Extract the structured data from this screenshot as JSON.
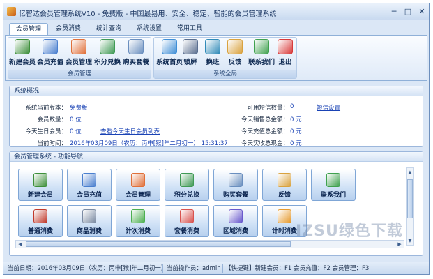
{
  "window": {
    "title": "亿智达会员管理系统V10 - 免费版 - 中国最易用、安全、稳定、智能的会员管理系统",
    "min_glyph": "─",
    "max_glyph": "□",
    "close_glyph": "✕"
  },
  "tabs": [
    {
      "label": "会员管理",
      "active": true
    },
    {
      "label": "会员消费"
    },
    {
      "label": "统计查询"
    },
    {
      "label": "系统设置"
    },
    {
      "label": "常用工具"
    }
  ],
  "ribbon": {
    "groups": [
      {
        "caption": "会员管理",
        "buttons": [
          {
            "label": "新建会员",
            "icon": "add-user-icon",
            "color": "#3d8f3a"
          },
          {
            "label": "会员充值",
            "icon": "pen-icon",
            "color": "#4a7fcf"
          },
          {
            "label": "会员管理",
            "icon": "member-card-icon",
            "color": "#e0703a"
          },
          {
            "label": "积分兑换",
            "icon": "gift-icon",
            "color": "#3f9a55"
          },
          {
            "label": "购买套餐",
            "icon": "basket-icon",
            "color": "#6a8fbf"
          }
        ]
      },
      {
        "caption": "系统全局",
        "buttons": [
          {
            "label": "系统首页",
            "icon": "home-icon",
            "color": "#3f8ed6"
          },
          {
            "label": "锁屏",
            "icon": "lock-icon",
            "color": "#5a6f90"
          },
          {
            "label": "换班",
            "icon": "shift-change-icon",
            "color": "#2f8ab8"
          },
          {
            "label": "反馈",
            "icon": "feedback-icon",
            "color": "#d9a23e"
          },
          {
            "label": "联系我们",
            "icon": "phone-icon",
            "color": "#3fa14e"
          },
          {
            "label": "退出",
            "icon": "power-icon",
            "color": "#d83a3a"
          }
        ]
      }
    ]
  },
  "overview": {
    "header": "系统概况",
    "left": [
      {
        "label": "系统当前版本：",
        "value": "免费版"
      },
      {
        "label": "会员数量：",
        "value": "0 位"
      },
      {
        "label": "今天生日会员：",
        "value": "0 位",
        "link": "查看今天生日会员列表"
      },
      {
        "label": "当前时间：",
        "value": "2016年03月09日（农历：丙申[猴]年二月初一）   15:31:37"
      }
    ],
    "right": [
      {
        "label": "可用短信数量：",
        "value": "0",
        "link": "短信设置"
      },
      {
        "label": "今天销售总金额：",
        "value": "0 元"
      },
      {
        "label": "今天充值总金额：",
        "value": "0 元"
      },
      {
        "label": "今天实收总现金：",
        "value": "0 元"
      }
    ]
  },
  "nav": {
    "header": "会员管理系统 - 功能导航",
    "tiles": [
      {
        "label": "新建会员",
        "icon": "add-user-icon",
        "color": "#3d8f3a"
      },
      {
        "label": "会员充值",
        "icon": "pen-icon",
        "color": "#4a7fcf"
      },
      {
        "label": "会员管理",
        "icon": "member-card-icon",
        "color": "#e0703a"
      },
      {
        "label": "积分兑换",
        "icon": "gift-icon",
        "color": "#3f9a55"
      },
      {
        "label": "购买套餐",
        "icon": "basket-icon",
        "color": "#6a8fbf"
      },
      {
        "label": "反馈",
        "icon": "feedback-icon",
        "color": "#d9a23e"
      },
      {
        "label": "联系我们",
        "icon": "phone-icon",
        "color": "#3fa14e"
      },
      {
        "label": "普通消费",
        "icon": "grid-icon",
        "color": "#c0392b"
      },
      {
        "label": "商品消费",
        "icon": "cart-icon",
        "color": "#7b8ba3"
      },
      {
        "label": "计次消费",
        "icon": "ticket-icon",
        "color": "#4caf50"
      },
      {
        "label": "套餐消费",
        "icon": "package-icon",
        "color": "#d9534f"
      },
      {
        "label": "区域消费",
        "icon": "area-grid-icon",
        "color": "#6a5acd"
      },
      {
        "label": "计时消费",
        "icon": "clock-icon",
        "color": "#e69a2e"
      }
    ]
  },
  "watermark": "IZSU绿色下载",
  "status": {
    "date": "当前日期：2016年03月09日（农历：丙申[猴]年二月初一）",
    "operator": "当前操作员：admin",
    "shortcuts": "【快捷键】新建会员：F1  会员充值：F2  会员管理：F3"
  }
}
